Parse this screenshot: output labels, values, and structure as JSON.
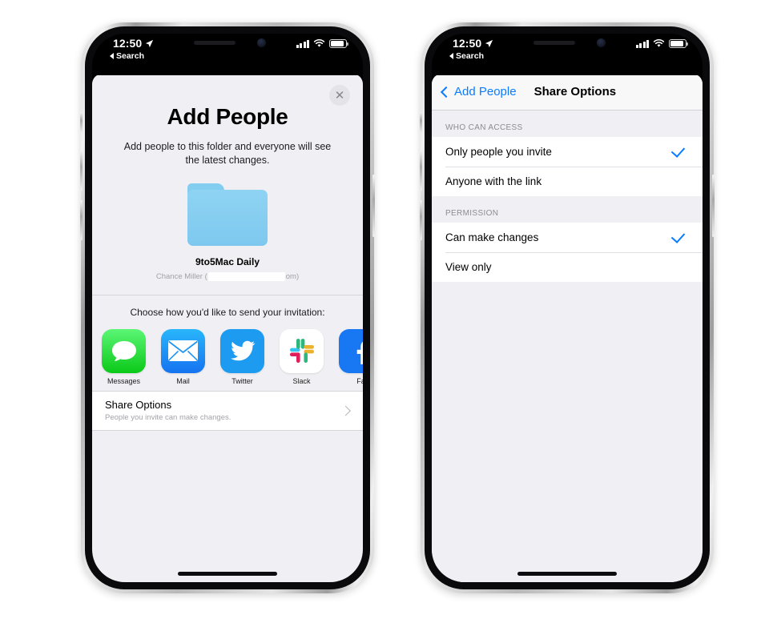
{
  "status_bar": {
    "time": "12:50",
    "location_icon": "location-arrow-icon",
    "back_app": "Search",
    "signal_icon": "cellular-signal-icon",
    "wifi_icon": "wifi-icon",
    "battery_icon": "battery-icon"
  },
  "phone_left": {
    "close_label": "✕",
    "title": "Add People",
    "subtitle": "Add people to this folder and everyone will see the latest changes.",
    "folder": {
      "icon": "folder-icon",
      "name": "9to5Mac Daily",
      "owner_prefix": "Chance Miller (",
      "owner_redacted": "",
      "owner_suffix": "om)"
    },
    "invite_prompt": "Choose how you'd like to send your invitation:",
    "apps": [
      {
        "label": "Messages",
        "icon": "messages-app-icon"
      },
      {
        "label": "Mail",
        "icon": "mail-app-icon"
      },
      {
        "label": "Twitter",
        "icon": "twitter-app-icon"
      },
      {
        "label": "Slack",
        "icon": "slack-app-icon"
      },
      {
        "label": "Fa",
        "icon": "facebook-app-icon"
      }
    ],
    "share_options": {
      "title": "Share Options",
      "subtitle": "People you invite can make changes.",
      "chevron": "chevron-right-icon"
    }
  },
  "phone_right": {
    "nav": {
      "back_label": "Add People",
      "back_icon": "chevron-left-icon",
      "title": "Share Options"
    },
    "sections": [
      {
        "header": "WHO CAN ACCESS",
        "rows": [
          {
            "label": "Only people you invite",
            "checked": true
          },
          {
            "label": "Anyone with the link",
            "checked": false
          }
        ]
      },
      {
        "header": "PERMISSION",
        "rows": [
          {
            "label": "Can make changes",
            "checked": true
          },
          {
            "label": "View only",
            "checked": false
          }
        ]
      }
    ]
  },
  "colors": {
    "accent_blue": "#0a7cff",
    "sheet_bg": "#f0f0f4",
    "cell_bg": "#ffffff",
    "folder_blue": "#8ed3f2"
  }
}
